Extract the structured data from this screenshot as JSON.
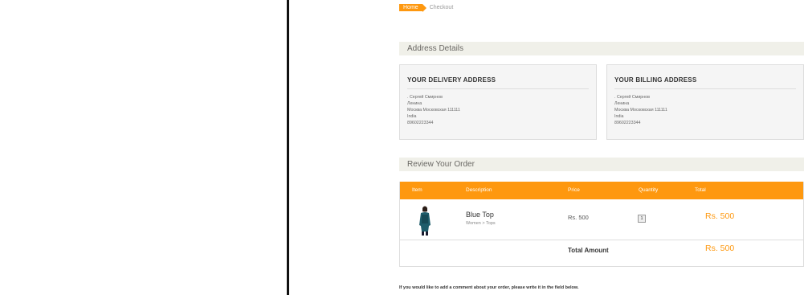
{
  "breadcrumb": {
    "home": "Home",
    "current": "Checkout"
  },
  "address_section": {
    "title": "Address Details",
    "delivery": {
      "heading": "YOUR DELIVERY ADDRESS",
      "lines": [
        ". Сергей Смирнов",
        "Ленина",
        "Москва Московская 111111",
        "India",
        "89602223344"
      ]
    },
    "billing": {
      "heading": "YOUR BILLING ADDRESS",
      "lines": [
        ". Сергей Смирнов",
        "Ленина",
        "Москва Московская 111111",
        "India",
        "89602223344"
      ]
    }
  },
  "review_section": {
    "title": "Review Your Order",
    "columns": {
      "item": "Item",
      "description": "Description",
      "price": "Price",
      "quantity": "Quantity",
      "total": "Total"
    },
    "items": [
      {
        "name": "Blue Top",
        "category": "Women > Tops",
        "price": "Rs. 500",
        "quantity": "1",
        "total": "Rs. 500"
      }
    ],
    "total_label": "Total Amount",
    "total_value": "Rs. 500"
  },
  "comment_note": "If you would like to add a comment about your order, please write it in the field below.",
  "colors": {
    "accent": "#fe980f",
    "section_bg": "#f0f0e9",
    "divider": "#111111"
  }
}
